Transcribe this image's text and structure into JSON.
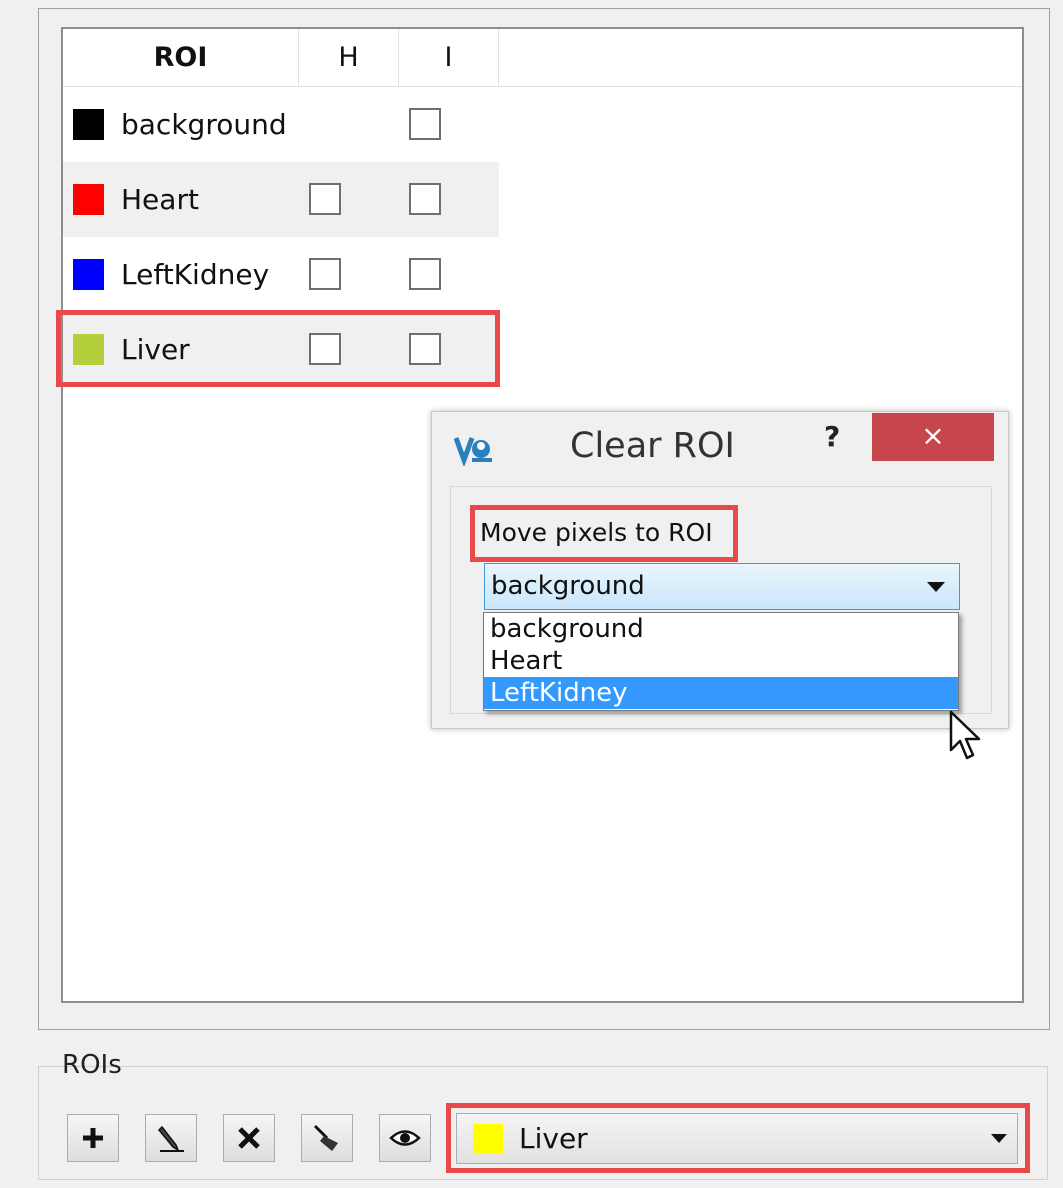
{
  "roi_table": {
    "columns": [
      "ROI",
      "H",
      "I"
    ],
    "rows": [
      {
        "name": "background",
        "color": "#000000"
      },
      {
        "name": "Heart",
        "color": "#ff0000"
      },
      {
        "name": "LeftKidney",
        "color": "#0000ff"
      },
      {
        "name": "Liver",
        "color": "#b3cf3b"
      }
    ]
  },
  "dialog": {
    "title": "Clear ROI",
    "help": "?",
    "close": "×",
    "move_label": "Move pixels to ROI",
    "selected": "background",
    "options": [
      "background",
      "Heart",
      "LeftKidney"
    ],
    "highlighted_option": "LeftKidney"
  },
  "rois_panel": {
    "title": "ROIs",
    "tools": [
      "add-icon",
      "pencil-icon",
      "delete-icon",
      "brush-icon",
      "eye-icon"
    ],
    "current_roi": "Liver",
    "current_roi_color": "#ffff00"
  },
  "colors": {
    "highlight": "#e8494b",
    "selection": "#3399ff",
    "close_button": "#c7464b"
  }
}
